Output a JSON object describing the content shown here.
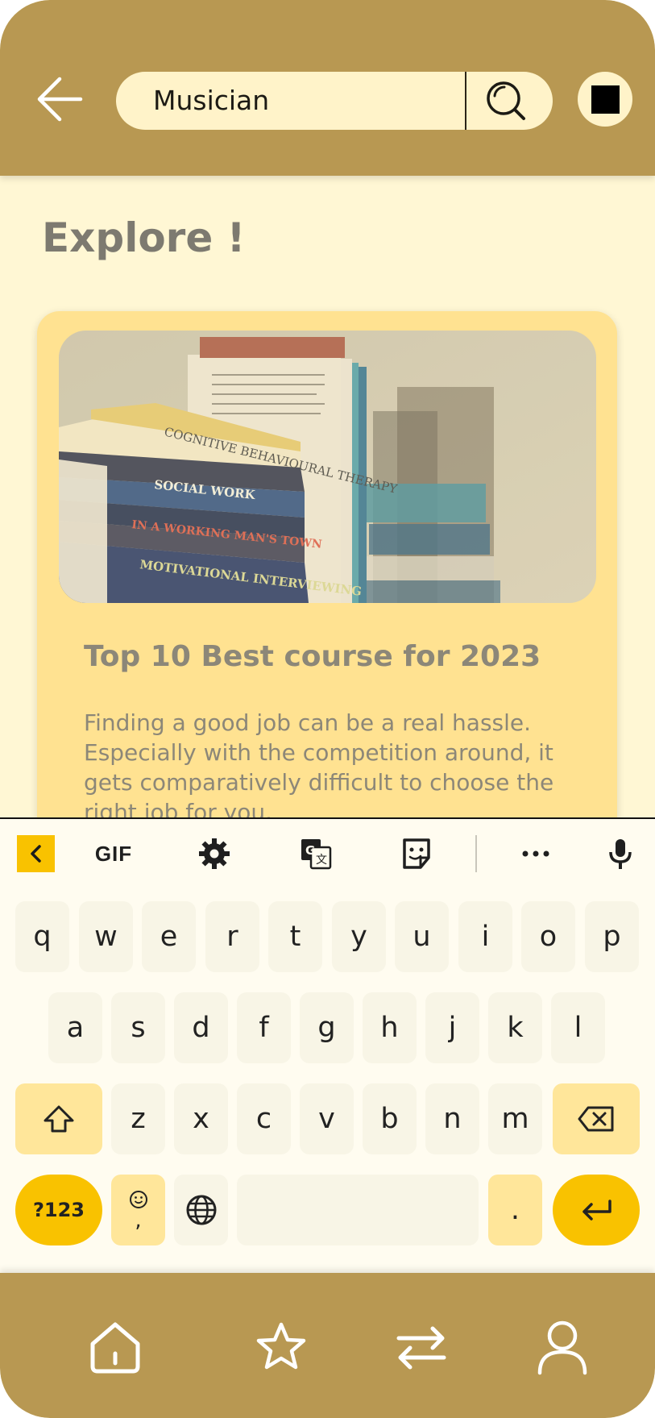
{
  "header": {
    "search_value": "Musician",
    "back_icon": "arrow-left-icon",
    "search_icon": "search-icon",
    "stop_icon": "stop-icon"
  },
  "explore": {
    "title": "Explore !"
  },
  "card": {
    "image_alt": "Stack of books on a shelf",
    "title": "Top 10 Best course for 2023",
    "description": "Finding a good job can be a real hassle. Especially with the competition around, it gets comparatively difficult to choose the right job for you.",
    "book_spines": [
      "COGNITIVE BEHAVIOURAL THERAPY",
      "SOCIAL WORK",
      "IN A WORKING MAN'S TOWN",
      "MOTIVATIONAL INTERVIEWING"
    ]
  },
  "keyboard": {
    "toolbar": {
      "gif_label": "GIF",
      "icons": [
        "chevron-left-icon",
        "settings-icon",
        "translate-icon",
        "sticker-icon",
        "more-icon",
        "microphone-icon"
      ]
    },
    "rows": [
      [
        "q",
        "w",
        "e",
        "r",
        "t",
        "y",
        "u",
        "i",
        "o",
        "p"
      ],
      [
        "a",
        "s",
        "d",
        "f",
        "g",
        "h",
        "j",
        "k",
        "l"
      ],
      [
        "z",
        "x",
        "c",
        "v",
        "b",
        "n",
        "m"
      ]
    ],
    "symbols_label": "?123",
    "comma_label": ",",
    "period_label": "."
  },
  "bottom_nav": {
    "items": [
      "home-icon",
      "star-icon",
      "swap-icon",
      "profile-icon"
    ]
  },
  "colors": {
    "header_bg": "#b89852",
    "page_bg": "#fff7d4",
    "card_bg": "#ffe291",
    "accent": "#f9c200"
  }
}
